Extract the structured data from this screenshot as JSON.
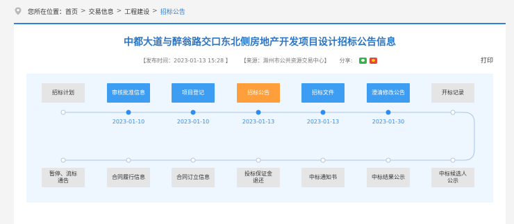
{
  "breadcrumb": {
    "prefix": "您所在位置：",
    "items": [
      "首页",
      "交易信息",
      "工程建设"
    ],
    "separator": ">",
    "current": "招标公告"
  },
  "page": {
    "title": "中都大道与醉翁路交口东北侧房地产开发项目设计招标公告信息",
    "publish_time": "【发布时间：2023-01-13 15:28 】",
    "source": "【来源：滁州市公共资源交易中心】",
    "share_label": "分享:",
    "print_label": "打印"
  },
  "colors": {
    "accent": "#2b76c6",
    "active": "#3c9df3",
    "current": "#ff9f3b",
    "inactive": "#e5e5e5"
  },
  "flow": {
    "top_steps": [
      {
        "label": "招标计划",
        "status": "inactive"
      },
      {
        "label": "审核批准信息",
        "status": "active"
      },
      {
        "label": "项目登记",
        "status": "active"
      },
      {
        "label": "招标公告",
        "status": "current"
      },
      {
        "label": "招标文件",
        "status": "active"
      },
      {
        "label": "澄清修改公告",
        "status": "active"
      },
      {
        "label": "开标记录",
        "status": "inactive"
      }
    ],
    "dates": [
      "2023-01-10",
      "2023-01-10",
      "2023-01-13",
      "2023-01-13",
      "2023-01-30"
    ],
    "bottom_steps": [
      {
        "label": "暂停、流标\n通告",
        "status": "inactive"
      },
      {
        "label": "合同履行信息",
        "status": "inactive"
      },
      {
        "label": "合同订立信息",
        "status": "inactive"
      },
      {
        "label": "投标保证金\n退还",
        "status": "inactive"
      },
      {
        "label": "中标通知书",
        "status": "inactive"
      },
      {
        "label": "中标结果公示",
        "status": "inactive"
      },
      {
        "label": "中标候选人\n公示",
        "status": "inactive"
      }
    ]
  }
}
